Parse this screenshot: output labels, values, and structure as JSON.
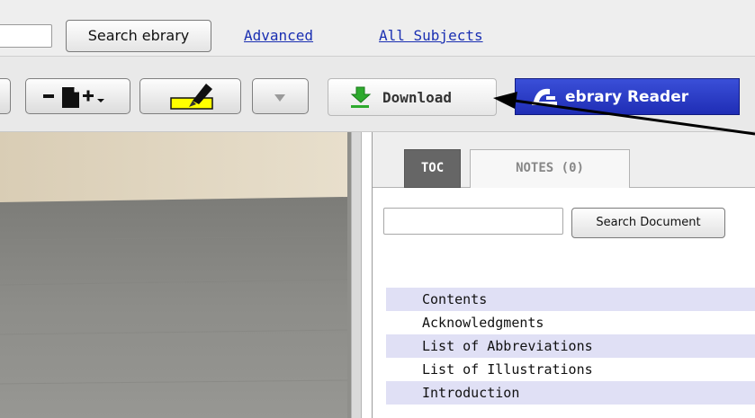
{
  "topbar": {
    "search_button": "Search ebrary",
    "advanced_link": "Advanced",
    "all_subjects_link": "All Subjects"
  },
  "toolbar": {
    "download_label": "Download",
    "reader_label": "ebrary Reader"
  },
  "panel": {
    "tabs": [
      {
        "label": "TOC",
        "active": true
      },
      {
        "label": "NOTES (0)",
        "active": false
      }
    ],
    "search_document_button": "Search Document",
    "toc_items": [
      "Contents",
      "Acknowledgments",
      "List of Abbreviations",
      "List of Illustrations",
      "Introduction"
    ]
  },
  "colors": {
    "link": "#1a2fb2",
    "reader_button": "#2433c4",
    "highlight_yellow": "#ffff00",
    "active_tab": "#666666",
    "toc_stripe": "#e0e0f5",
    "download_arrow": "#2eaa2e"
  }
}
